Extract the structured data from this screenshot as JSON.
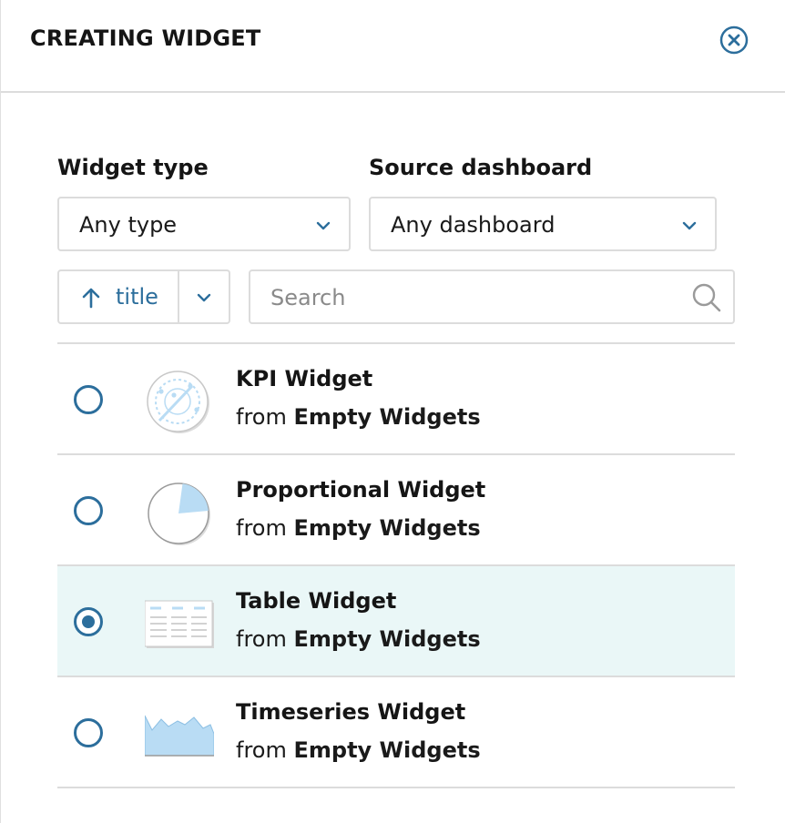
{
  "header": {
    "title": "CREATING WIDGET"
  },
  "filters": {
    "widget_type": {
      "label": "Widget type",
      "value": "Any type"
    },
    "source_dashboard": {
      "label": "Source dashboard",
      "value": "Any dashboard"
    }
  },
  "sort": {
    "label": "title",
    "direction": "ascending"
  },
  "search": {
    "placeholder": "Search",
    "value": ""
  },
  "colors": {
    "accent": "#2c6e9c",
    "selected_row": "#eaf7f7",
    "thumb_fill": "#b9dcf4",
    "border": "#dcdcdc"
  },
  "items": [
    {
      "name": "KPI Widget",
      "from_prefix": "from",
      "source": "Empty Widgets",
      "icon": "kpi-gauge-icon",
      "selected": false
    },
    {
      "name": "Proportional Widget",
      "from_prefix": "from",
      "source": "Empty Widgets",
      "icon": "pie-chart-icon",
      "selected": false
    },
    {
      "name": "Table Widget",
      "from_prefix": "from",
      "source": "Empty Widgets",
      "icon": "table-icon",
      "selected": true
    },
    {
      "name": "Timeseries Widget",
      "from_prefix": "from",
      "source": "Empty Widgets",
      "icon": "area-chart-icon",
      "selected": false
    }
  ]
}
